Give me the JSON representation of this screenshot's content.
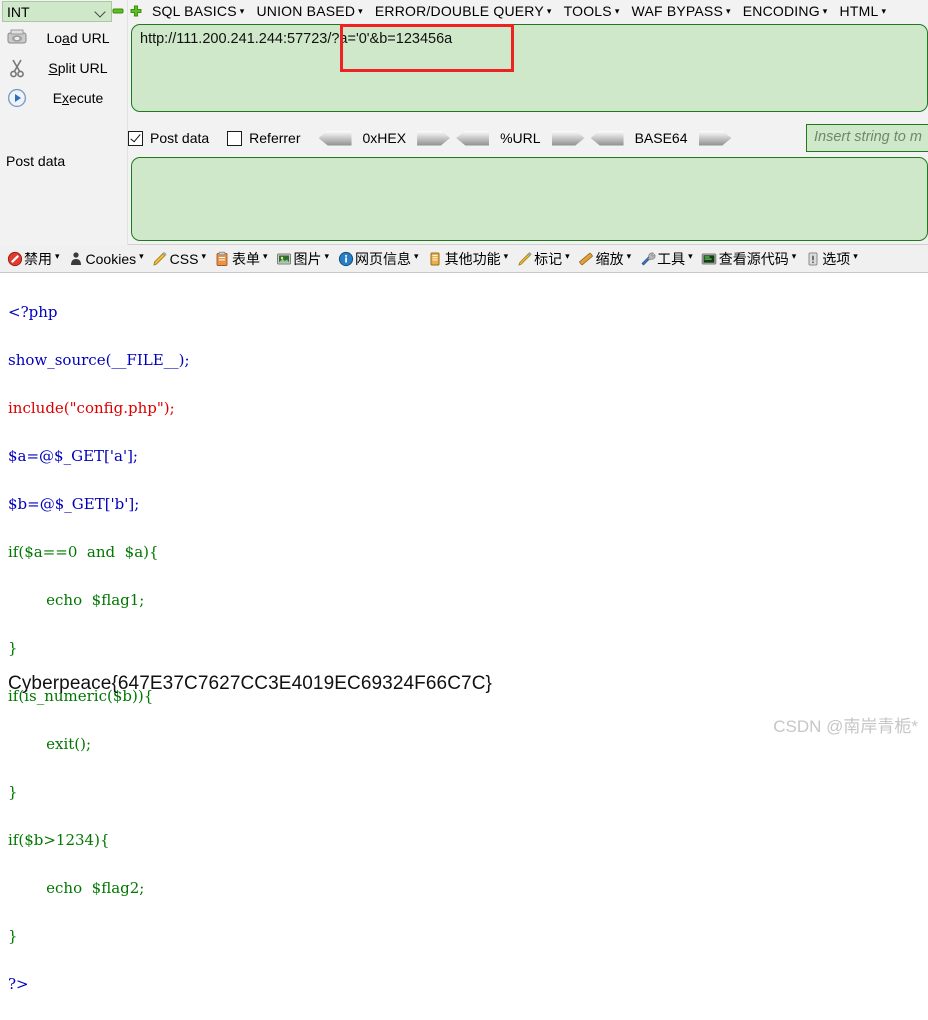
{
  "hackbar": {
    "type_select": {
      "value": "INT",
      "icon": "chevron-down-icon"
    },
    "minus_button": "–",
    "plus_button": "+",
    "menus": [
      {
        "label": "SQL BASICS",
        "caret": "▾"
      },
      {
        "label": "UNION BASED",
        "caret": "▾"
      },
      {
        "label": "ERROR/DOUBLE QUERY",
        "caret": "▾"
      },
      {
        "label": "TOOLS",
        "caret": "▾"
      },
      {
        "label": "WAF BYPASS",
        "caret": "▾"
      },
      {
        "label": "ENCODING",
        "caret": "▾"
      },
      {
        "label": "HTML",
        "caret": "▾"
      }
    ],
    "actions": [
      {
        "label_pre": "Lo",
        "label_u": "a",
        "label_post": "d URL",
        "icon": "load-url-icon"
      },
      {
        "label_pre": "",
        "label_u": "S",
        "label_post": "plit URL",
        "icon": "scissors-icon"
      },
      {
        "label_pre": "E",
        "label_u": "x",
        "label_post": "ecute",
        "icon": "play-icon"
      }
    ],
    "url_value": "http://111.200.241.244:57723/?a='0'&b=123456a",
    "post_data_label": "Post data",
    "options": {
      "post_data": {
        "label": "Post data",
        "checked": true
      },
      "referrer": {
        "label": "Referrer",
        "checked": false
      },
      "encoders": [
        "0xHEX",
        "%URL",
        "BASE64"
      ]
    },
    "insert_placeholder": "Insert string to m",
    "post_data_value": ""
  },
  "cn_toolbar": [
    {
      "label": "禁用",
      "icon": "block-icon",
      "caret": "▾"
    },
    {
      "label": "Cookies",
      "icon": "cookie-icon",
      "caret": "▾"
    },
    {
      "label": "CSS",
      "icon": "css-icon",
      "caret": "▾"
    },
    {
      "label": "表单",
      "icon": "form-icon",
      "caret": "▾"
    },
    {
      "label": "图片",
      "icon": "image-icon",
      "caret": "▾"
    },
    {
      "label": "网页信息",
      "icon": "info-icon",
      "caret": "▾"
    },
    {
      "label": "其他功能",
      "icon": "misc-icon",
      "caret": "▾"
    },
    {
      "label": "标记",
      "icon": "pencil-icon",
      "caret": "▾"
    },
    {
      "label": "缩放",
      "icon": "ruler-icon",
      "caret": "▾"
    },
    {
      "label": "工具",
      "icon": "tools-icon",
      "caret": "▾"
    },
    {
      "label": "查看源代码",
      "icon": "source-icon",
      "caret": "▾"
    },
    {
      "label": "选项",
      "icon": "options-icon",
      "caret": "▾"
    }
  ],
  "source": {
    "lines": [
      "<?php",
      "show_source(__FILE__);",
      "include(\"config.php\");",
      "$a=@$_GET['a'];",
      "$b=@$_GET['b'];",
      "if($a==0  and  $a){",
      "        echo  $flag1;",
      "}",
      "if(is_numeric($b)){",
      "        exit();",
      "}",
      "if($b>1234){",
      "        echo  $flag2;",
      "}",
      "?>"
    ]
  },
  "flag": "Cyberpeace{647E37C7627CC3E4019EC69324F66C7C}",
  "watermark": "CSDN @南岸青栀*",
  "colors": {
    "field_bg": "#cfe8c9",
    "field_border": "#1f7a1f",
    "highlight_box": "#ee2222",
    "panel_bg": "#f2f2f2"
  }
}
